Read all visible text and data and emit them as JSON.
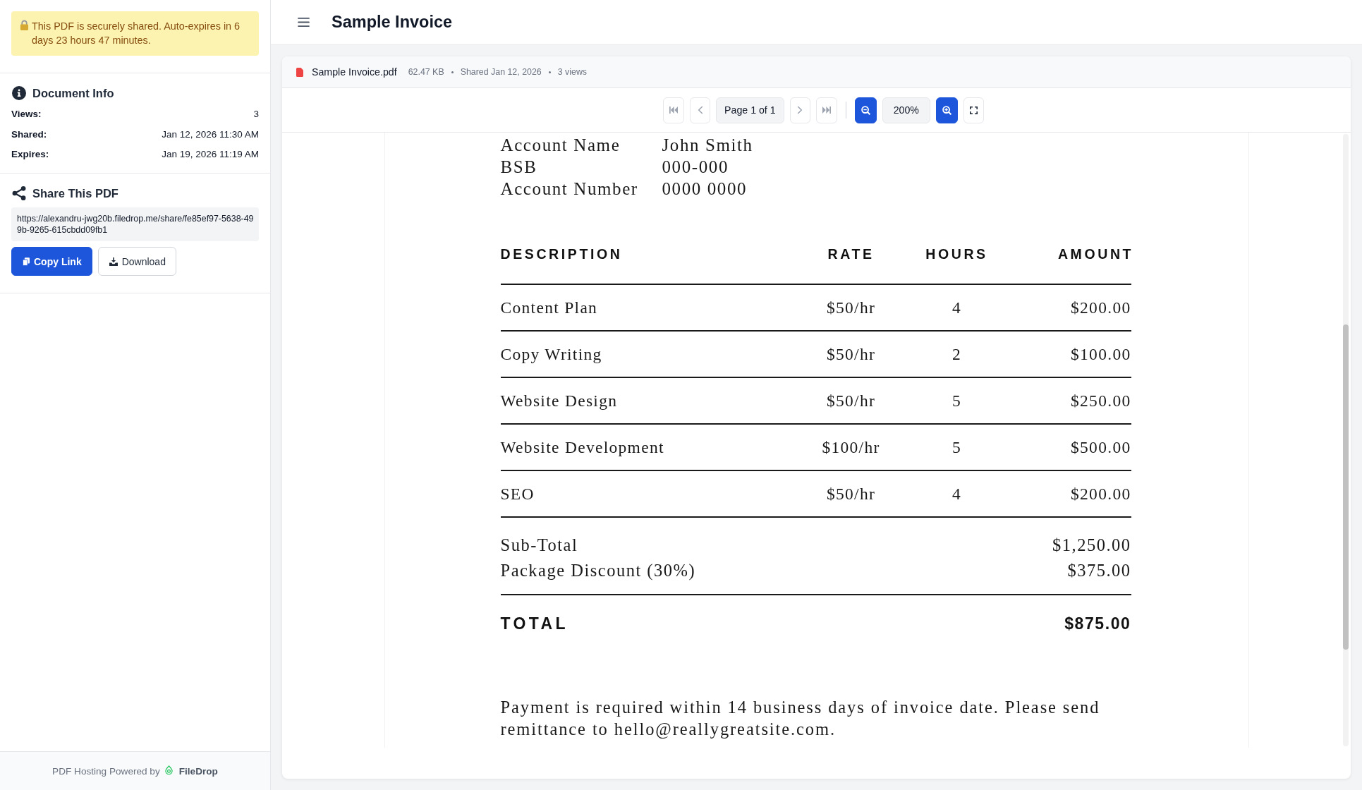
{
  "notice": {
    "text": "This PDF is securely shared. Auto-expires in 6 days 23 hours 47 minutes."
  },
  "document_info": {
    "title": "Document Info",
    "rows": [
      {
        "label": "Views:",
        "value": "3"
      },
      {
        "label": "Shared:",
        "value": "Jan 12, 2026 11:30 AM"
      },
      {
        "label": "Expires:",
        "value": "Jan 19, 2026 11:19 AM"
      }
    ]
  },
  "share": {
    "title": "Share This PDF",
    "url": "https://alexandru-jwg20b.filedrop.me/share/fe85ef97-5638-499b-9265-615cbdd09fb1",
    "buttons": [
      {
        "kind": "copy",
        "label": "Copy Link"
      },
      {
        "kind": "download",
        "label": "Download"
      }
    ]
  },
  "footer": {
    "text": "PDF Hosting Powered by",
    "brand": "FileDrop"
  },
  "header": {
    "title": "Sample Invoice"
  },
  "file_bar": {
    "name": "Sample Invoice.pdf",
    "meta": [
      "62.47 KB",
      "Shared Jan 12, 2026",
      "3 views"
    ]
  },
  "toolbar": [
    {
      "kind": "first",
      "disabled": true
    },
    {
      "kind": "prev",
      "disabled": true
    },
    {
      "kind": "page",
      "label": "Page 1 of 1"
    },
    {
      "kind": "next",
      "disabled": true
    },
    {
      "kind": "last",
      "disabled": true
    },
    {
      "kind": "divider"
    },
    {
      "kind": "zoom_out"
    },
    {
      "kind": "zoom",
      "label": "200%"
    },
    {
      "kind": "zoom_in"
    },
    {
      "kind": "fullscreen"
    }
  ],
  "invoice": {
    "account": [
      {
        "label": "Account Name",
        "value": "John Smith"
      },
      {
        "label": "BSB",
        "value": "000-000"
      },
      {
        "label": "Account Number",
        "value": "0000 0000"
      }
    ],
    "columns": [
      "DESCRIPTION",
      "RATE",
      "HOURS",
      "AMOUNT"
    ],
    "rows": [
      {
        "description": "Content Plan",
        "rate": "$50/hr",
        "hours": "4",
        "amount": "$200.00"
      },
      {
        "description": "Copy Writing",
        "rate": "$50/hr",
        "hours": "2",
        "amount": "$100.00"
      },
      {
        "description": "Website Design",
        "rate": "$50/hr",
        "hours": "5",
        "amount": "$250.00"
      },
      {
        "description": "Website Development",
        "rate": "$100/hr",
        "hours": "5",
        "amount": "$500.00"
      },
      {
        "description": "SEO",
        "rate": "$50/hr",
        "hours": "4",
        "amount": "$200.00"
      }
    ],
    "summary": [
      {
        "label": "Sub-Total",
        "value": "$1,250.00"
      },
      {
        "label": "Package Discount (30%)",
        "value": "$375.00"
      }
    ],
    "total": {
      "label": "TOTAL",
      "value": "$875.00"
    },
    "note": "Payment is required within 14 business days of invoice date. Please send remittance to hello@reallygreatsite.com."
  }
}
